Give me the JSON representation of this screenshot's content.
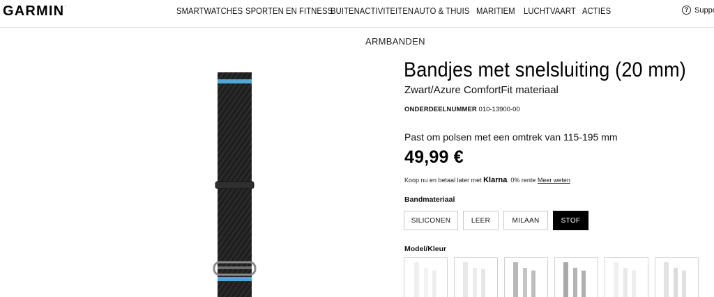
{
  "header": {
    "logo": "GARMIN",
    "logo_mark": ".",
    "nav": [
      "SMARTWATCHES",
      "SPORTEN EN FITNESS",
      "BUITENACTIVITEITEN",
      "AUTO & THUIS",
      "MARITIEM",
      "LUCHTVAART",
      "ACTIES"
    ],
    "support_label": "Suppo",
    "support_icon": "question-circle-icon"
  },
  "product": {
    "category": "ARMBANDEN",
    "title": "Bandjes met snelsluiting (20 mm)",
    "subtitle": "Zwart/Azure ComfortFit materiaal",
    "part_number_label": "ONDERDEELNUMMER",
    "part_number": "010-13900-00",
    "fits": "Past om polsen met een omtrek van 115-195 mm",
    "price": "49,99 €",
    "klarna": {
      "prefix": "Koop nu en betaal later met",
      "brand": "Klarna",
      "suffix": ". 0% rente",
      "link": "Meer weten"
    },
    "band_material_label": "Bandmateriaal",
    "band_options": [
      "SILICONEN",
      "LEER",
      "MILAAN",
      "STOF"
    ],
    "band_selected": "STOF",
    "model_color_label": "Model/Kleur",
    "thumbnail_count": 6
  },
  "colors": {
    "strap_dark": "#1f1f1f",
    "strap_accent": "#4ea8d6",
    "selected_bg": "#000000"
  }
}
